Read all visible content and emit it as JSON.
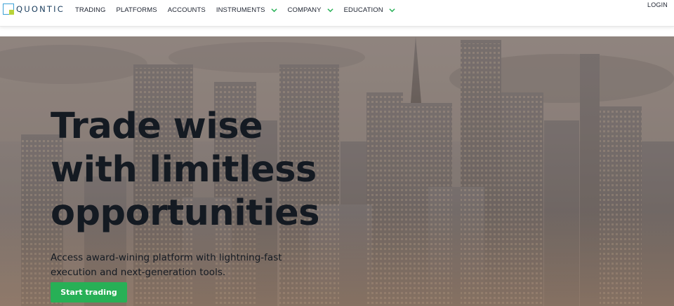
{
  "brand": {
    "name": "QUONTIC",
    "accent": "#27b056",
    "logo_blue": "#3aa0d6",
    "logo_lime": "#b9d33a"
  },
  "nav": {
    "items": [
      {
        "label": "TRADING",
        "has_dropdown": false
      },
      {
        "label": "PLATFORMS",
        "has_dropdown": false
      },
      {
        "label": "ACCOUNTS",
        "has_dropdown": false
      },
      {
        "label": "INSTRUMENTS",
        "has_dropdown": true
      },
      {
        "label": "COMPANY",
        "has_dropdown": true
      },
      {
        "label": "EDUCATION",
        "has_dropdown": true
      }
    ],
    "dropdown_icon": "chevron-down-icon",
    "login_label": "LOGIN"
  },
  "hero": {
    "title_lines": [
      "Trade wise",
      "with limitless",
      "opportunities"
    ],
    "subtitle_lines": [
      "Access award-wining platform with lightning-fast",
      "execution and next-generation tools."
    ],
    "cta_label": "Start trading",
    "background": "city-skyline-image"
  }
}
